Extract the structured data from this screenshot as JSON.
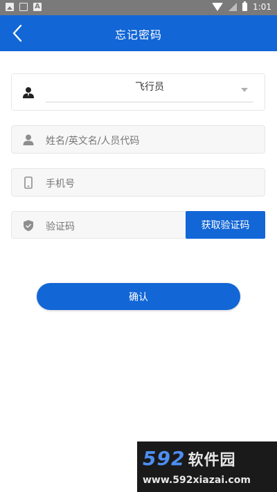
{
  "status_bar": {
    "time": "1:01",
    "a_icon": "A"
  },
  "header": {
    "title": "忘记密码"
  },
  "form": {
    "role": {
      "value": "飞行员"
    },
    "name": {
      "placeholder": "姓名/英文名/人员代码"
    },
    "phone": {
      "placeholder": "手机号"
    },
    "code": {
      "placeholder": "验证码",
      "button_label": "获取验证码"
    }
  },
  "confirm_label": "确认",
  "watermark": {
    "brand_num": "592",
    "brand_cn": "软件园",
    "url": "www.592xiazai.com"
  },
  "colors": {
    "primary": "#1266d6",
    "status_bar": "#7a7a7a",
    "field_bg": "#f7f7f7"
  }
}
